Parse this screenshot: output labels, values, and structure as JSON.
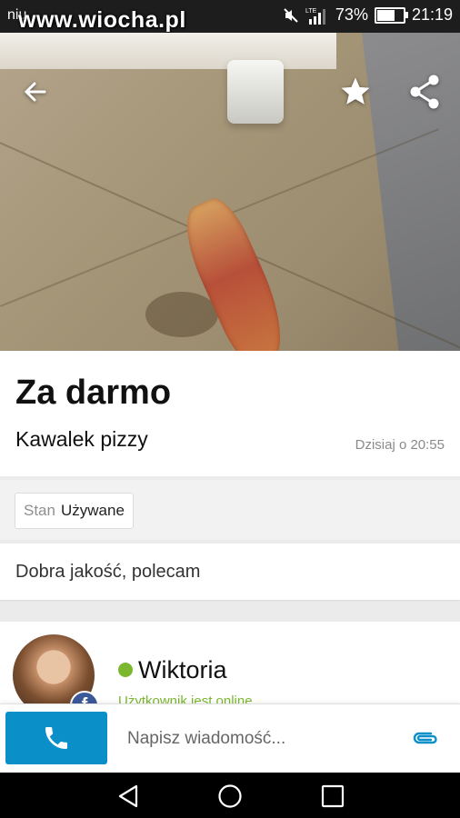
{
  "status_bar": {
    "carrier": "niu",
    "watermark": "www.wiocha.pl",
    "network": "LTE",
    "battery": "73%",
    "battery_level": 0.73,
    "time": "21:19"
  },
  "listing": {
    "title": "Za darmo",
    "subtitle": "Kawalek pizzy",
    "date": "Dzisiaj o 20:55",
    "param_key": "Stan",
    "param_value": "Używane",
    "description": "Dobra jakość, polecam"
  },
  "user": {
    "name": "Wiktoria",
    "status": "Użytkownik jest online",
    "badge": "f"
  },
  "contact": {
    "message_placeholder": "Napisz wiadomość..."
  },
  "colors": {
    "accent": "#0a8fc9",
    "online": "#7cb82f",
    "facebook": "#3b5998"
  },
  "icons": [
    "back-arrow-icon",
    "star-icon",
    "share-icon",
    "phone-icon",
    "paperclip-icon",
    "nav-back-icon",
    "nav-home-icon",
    "nav-recents-icon"
  ]
}
